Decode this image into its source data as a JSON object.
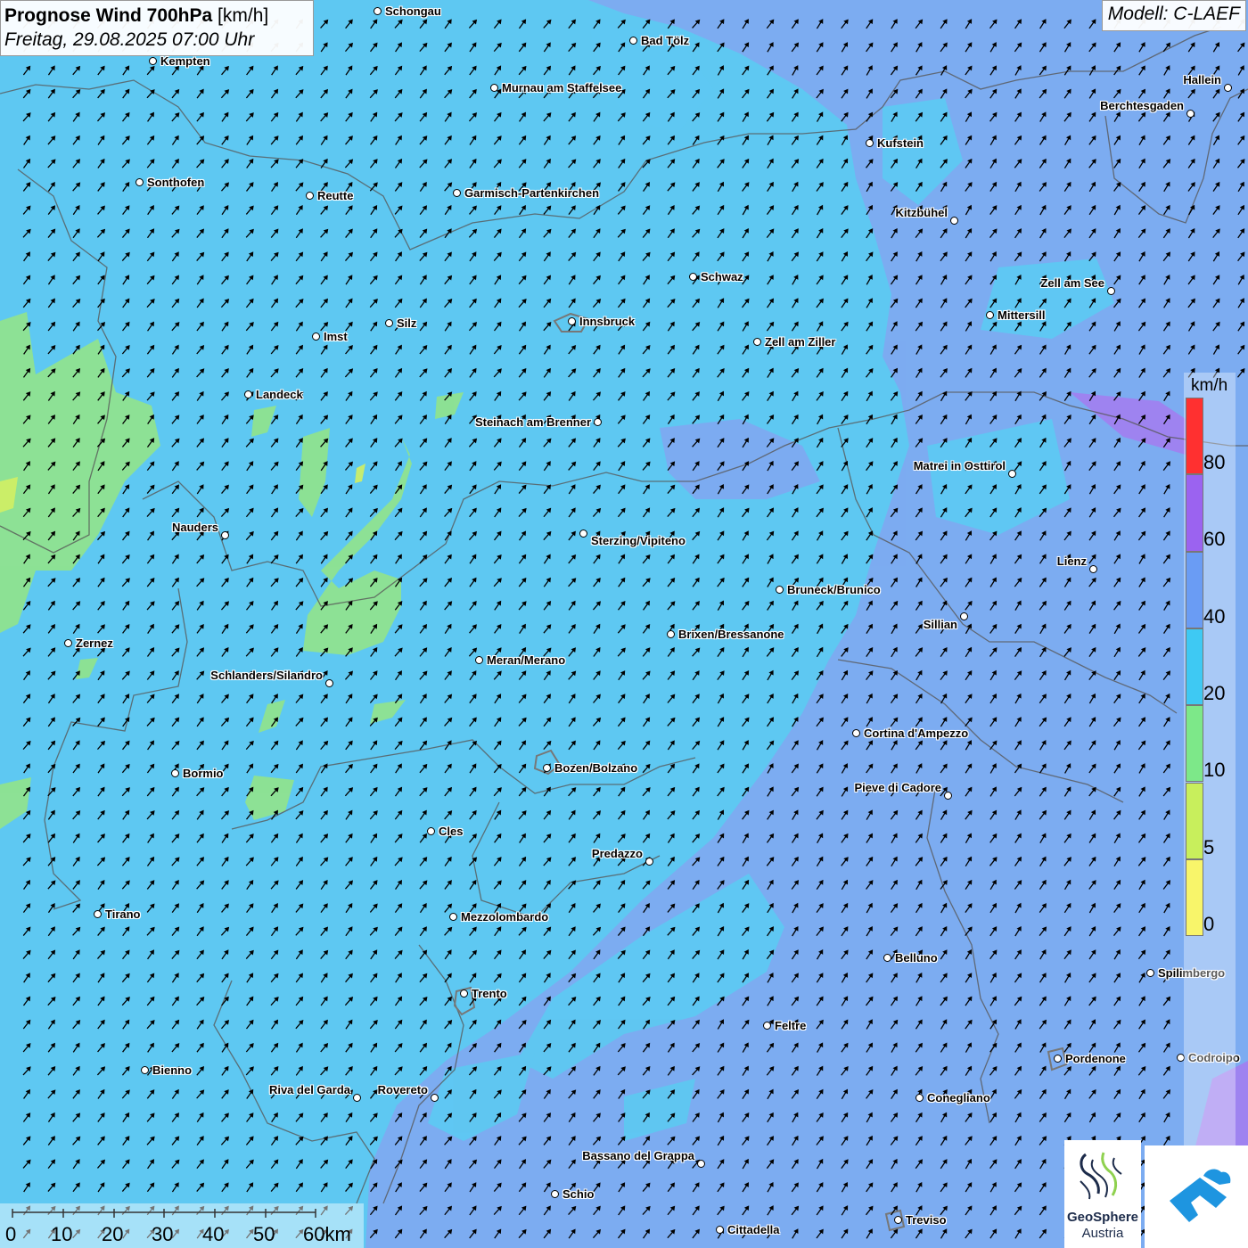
{
  "header": {
    "title_bold": "Prognose Wind 700hPa",
    "title_unit": "[km/h]",
    "datetime": "Freitag, 29.08.2025 07:00 Uhr",
    "model": "Modell: C-LAEF"
  },
  "legend": {
    "unit": "km/h",
    "bins": [
      {
        "label": "80",
        "color": "#ff3030"
      },
      {
        "label": "60",
        "color": "#9b63f0"
      },
      {
        "label": "40",
        "color": "#6a9cf4"
      },
      {
        "label": "20",
        "color": "#3ec9f3"
      },
      {
        "label": "10",
        "color": "#7de889"
      },
      {
        "label": "5",
        "color": "#c8ef5c"
      },
      {
        "label": "0",
        "color": "#f8f56a"
      }
    ]
  },
  "scale_bar": {
    "labels": [
      "0",
      "10",
      "20",
      "30",
      "40",
      "50",
      "60km"
    ]
  },
  "wind": {
    "direction": "from south-west",
    "arrow_color": "#000000"
  },
  "cities": [
    {
      "name": "Schongau"
    },
    {
      "name": "Bad Tölz"
    },
    {
      "name": "Kempten"
    },
    {
      "name": "Murnau am Staffelsee"
    },
    {
      "name": "Hallein"
    },
    {
      "name": "Berchtesgaden"
    },
    {
      "name": "Kufstein"
    },
    {
      "name": "Sonthofen"
    },
    {
      "name": "Reutte"
    },
    {
      "name": "Garmisch-Partenkirchen"
    },
    {
      "name": "Kitzbühel"
    },
    {
      "name": "Schwaz"
    },
    {
      "name": "Zell am See"
    },
    {
      "name": "Innsbruck"
    },
    {
      "name": "Mittersill"
    },
    {
      "name": "Imst"
    },
    {
      "name": "Silz"
    },
    {
      "name": "Zell am Ziller"
    },
    {
      "name": "Landeck"
    },
    {
      "name": "Steinach am Brenner"
    },
    {
      "name": "Matrei in Osttirol"
    },
    {
      "name": "Nauders"
    },
    {
      "name": "Sterzing/Vipiteno"
    },
    {
      "name": "Lienz"
    },
    {
      "name": "Bruneck/Brunico"
    },
    {
      "name": "Sillian"
    },
    {
      "name": "Zernez"
    },
    {
      "name": "Brixen/Bressanone"
    },
    {
      "name": "Meran/Merano"
    },
    {
      "name": "Schlanders/Silandro"
    },
    {
      "name": "Cortina d'Ampezzo"
    },
    {
      "name": "Bozen/Bolzano"
    },
    {
      "name": "Bormio"
    },
    {
      "name": "Pieve di Cadore"
    },
    {
      "name": "Cles"
    },
    {
      "name": "Predazzo"
    },
    {
      "name": "Tirano"
    },
    {
      "name": "Mezzolombardo"
    },
    {
      "name": "Belluno"
    },
    {
      "name": "Spilimbergo"
    },
    {
      "name": "Trento"
    },
    {
      "name": "Feltre"
    },
    {
      "name": "Pordenone"
    },
    {
      "name": "Codroipo"
    },
    {
      "name": "Bienno"
    },
    {
      "name": "Riva del Garda"
    },
    {
      "name": "Rovereto"
    },
    {
      "name": "Conegliano"
    },
    {
      "name": "Bassano del Grappa"
    },
    {
      "name": "Schio"
    },
    {
      "name": "Treviso"
    },
    {
      "name": "Cittadella"
    }
  ],
  "logos": {
    "geosphere_line1": "GeoSphere",
    "geosphere_line2": "Austria"
  }
}
